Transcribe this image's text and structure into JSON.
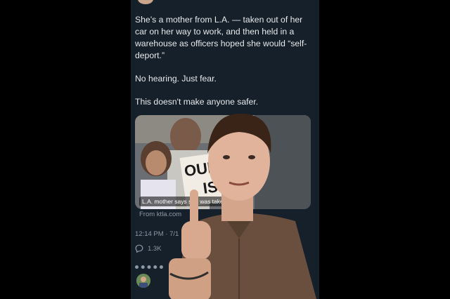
{
  "tweet": {
    "paragraphs": [
      "She’s a mother from L.A. — taken out of her car on her way to work, and then held in a warehouse as officers hoped she would “self-deport.”",
      "No hearing. Just fear.",
      "This doesn't make anyone safer."
    ]
  },
  "card": {
    "sign_line1": "OUR MO",
    "sign_line2": "IS",
    "caption": "L.A. mother says she was taken to U",
    "source": "From ktla.com"
  },
  "meta": {
    "timestamp": "12:14 PM · 7/1",
    "reply_count": "1.3K"
  },
  "icons": {
    "reply": "reply-icon",
    "avatar": "avatar"
  },
  "colors": {
    "background": "#000000",
    "panel": "#15202b",
    "text": "#e7e9ea",
    "muted": "#8b98a5"
  }
}
